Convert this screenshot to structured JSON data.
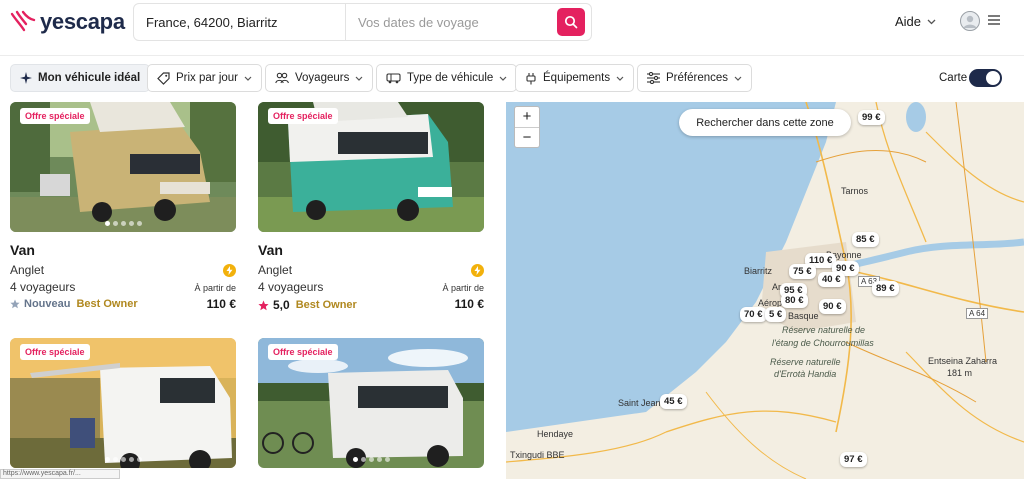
{
  "header": {
    "logo_text": "yescapa",
    "search_location": "France, 64200, Biarritz",
    "search_dates_placeholder": "Vos dates de voyage",
    "help_label": "Aide"
  },
  "filters": {
    "ideal_vehicle": "Mon véhicule idéal",
    "price_per_day": "Prix par jour",
    "travelers": "Voyageurs",
    "vehicle_type": "Type de véhicule",
    "equipment": "Équipements",
    "preferences": "Préférences",
    "map_label": "Carte"
  },
  "listings": [
    {
      "badge": "Offre spéciale",
      "title": "Van",
      "city": "Anglet",
      "travelers": "4 voyageurs",
      "status": "Nouveau",
      "owner_badge": "Best Owner",
      "price_prefix": "À partir de",
      "price": "110 €"
    },
    {
      "badge": "Offre spéciale",
      "title": "Van",
      "city": "Anglet",
      "travelers": "4 voyageurs",
      "rating": "5,0",
      "owner_badge": "Best Owner",
      "price_prefix": "À partir de",
      "price": "110 €"
    },
    {
      "badge": "Offre spéciale"
    },
    {
      "badge": "Offre spéciale"
    }
  ],
  "map": {
    "search_zone": "Rechercher dans cette zone",
    "zoom_in": "+",
    "zoom_out": "−",
    "places": [
      "Tarnos",
      "Bayonne",
      "Biarritz",
      "Anglet",
      "Aéroport",
      "Basque",
      "Réserve naturelle de",
      "l'étang de Chourroumillas",
      "Réserve naturelle",
      "d'Errotà Handia",
      "Entseina Zaharra",
      "181 m",
      "Saint Jean",
      "Hendaye",
      "Txingudi BBE",
      "A 63",
      "A 64"
    ],
    "pins": [
      "99 €",
      "85 €",
      "110 €",
      "90 €",
      "75 €",
      "40 €",
      "89 €",
      "95 €",
      "80 €",
      "90 €",
      "70 €",
      "5 €",
      "45 €",
      "97 €"
    ]
  },
  "statusbar_url": "https://www.yescapa.fr/..."
}
